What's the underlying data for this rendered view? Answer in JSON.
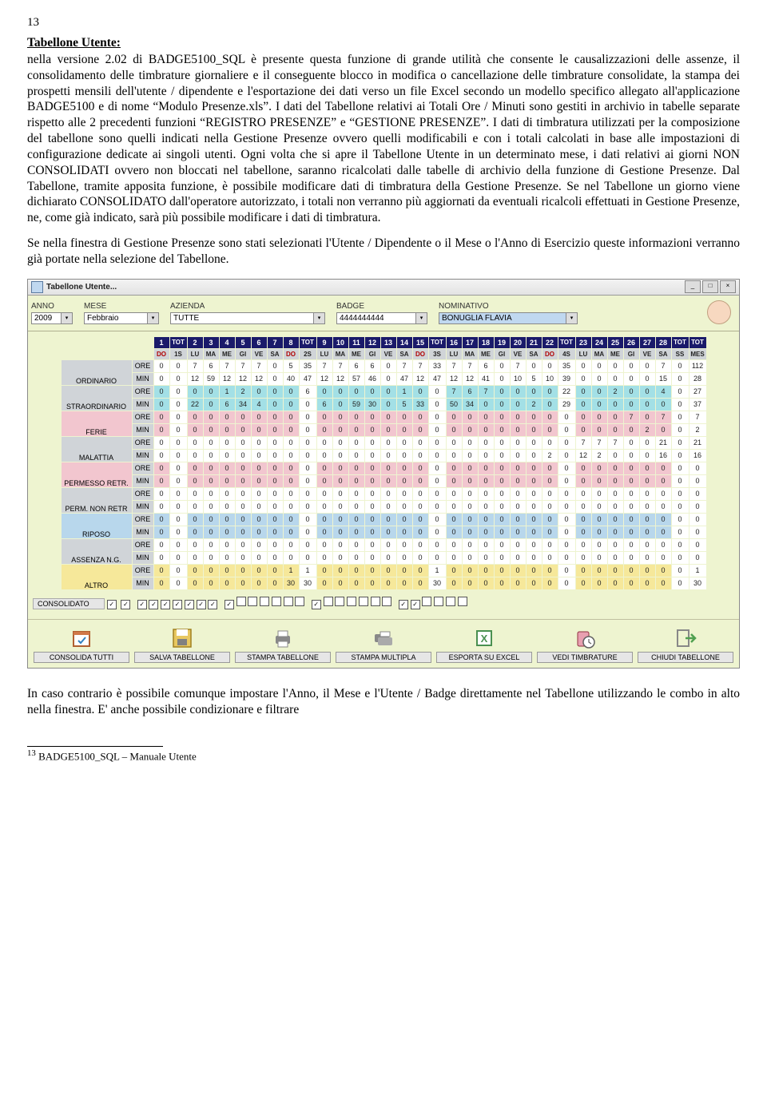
{
  "page": {
    "number": "13",
    "heading": "Tabellone Utente:",
    "para1": "nella versione 2.02 di BADGE5100_SQL è presente questa funzione di grande utilità che consente le causalizzazioni delle assenze, il consolidamento delle timbrature giornaliere e il conseguente blocco in modifica o cancellazione delle timbrature consolidate, la stampa dei prospetti mensili dell'utente / dipendente e l'esportazione dei dati verso un file Excel secondo un modello specifico allegato all'applicazione BADGE5100 e di nome “Modulo Presenze.xls”. I dati del Tabellone relativi ai Totali Ore / Minuti sono gestiti in archivio in tabelle separate rispetto alle 2 precedenti funzioni “REGISTRO PRESENZE” e “GESTIONE PRESENZE”. I dati di timbratura utilizzati per la composizione del tabellone sono quelli indicati nella Gestione Presenze ovvero quelli modificabili e con i totali calcolati in base alle impostazioni di configurazione dedicate ai singoli utenti. Ogni volta che si apre il Tabellone Utente in un determinato mese, i dati relativi ai giorni NON CONSOLIDATI ovvero non bloccati nel tabellone, saranno ricalcolati dalle tabelle di archivio della funzione di Gestione Presenze. Dal Tabellone, tramite apposita funzione, è possibile modificare dati di timbratura della Gestione Presenze. Se nel Tabellone un giorno viene dichiarato CONSOLIDATO dall'operatore autorizzato, i totali non verranno più aggiornati da eventuali ricalcoli effettuati in Gestione Presenze, ne, come già indicato, sarà più possibile modificare i dati di timbratura.",
    "para2": "Se nella finestra di Gestione Presenze sono stati selezionati l'Utente / Dipendente o il Mese o l'Anno di Esercizio queste informazioni verranno già portate nella selezione del Tabellone.",
    "para3": "In caso contrario è possibile comunque impostare l'Anno, il Mese e l'Utente / Badge direttamente nel Tabellone utilizzando le combo in alto nella finestra. E' anche possibile condizionare e filtrare",
    "footnote_num": "13",
    "footnote_text": "BADGE5100_SQL – Manuale Utente"
  },
  "app": {
    "title": "Tabellone Utente...",
    "filters": {
      "anno": {
        "label": "ANNO",
        "value": "2009"
      },
      "mese": {
        "label": "MESE",
        "value": "Febbraio"
      },
      "azienda": {
        "label": "AZIENDA",
        "value": "TUTTE"
      },
      "badge": {
        "label": "BADGE",
        "value": "4444444444"
      },
      "nominativo": {
        "label": "NOMINATIVO",
        "value": "BONUGLIA FLAVIA"
      }
    },
    "grid": {
      "days": [
        1,
        2,
        3,
        4,
        5,
        6,
        7,
        8,
        9,
        10,
        11,
        12,
        13,
        14,
        15,
        16,
        17,
        18,
        19,
        20,
        21,
        22,
        23,
        24,
        25,
        26,
        27,
        28
      ],
      "dow": [
        "DO",
        "LU",
        "MA",
        "ME",
        "GI",
        "VE",
        "SA",
        "DO",
        "LU",
        "MA",
        "ME",
        "GI",
        "VE",
        "SA",
        "DO",
        "LU",
        "MA",
        "ME",
        "GI",
        "VE",
        "SA",
        "DO",
        "LU",
        "MA",
        "ME",
        "GI",
        "VE",
        "SA"
      ],
      "tot_labels": {
        "t1": "TOT",
        "t2": "TOT",
        "t3": "TOT",
        "t4": "TOT",
        "tot": "TOT"
      },
      "dow_tot": {
        "t1": "1S",
        "t2": "2S",
        "t3": "3S",
        "t4": "4S",
        "ss": "SS",
        "mes": "MES"
      },
      "day_cols": 28,
      "rows": [
        {
          "label": "ORDINARIO",
          "unit_ore": "ORE",
          "unit_min": "MIN",
          "class": "",
          "ore": [
            0,
            7,
            6,
            7,
            7,
            7,
            0,
            5,
            7,
            7,
            6,
            6,
            0,
            7,
            7,
            7,
            7,
            6,
            0,
            7,
            0,
            0,
            0,
            0,
            0,
            0,
            0,
            7
          ],
          "min": [
            0,
            12,
            59,
            12,
            12,
            12,
            0,
            40,
            12,
            12,
            57,
            46,
            0,
            47,
            12,
            12,
            12,
            41,
            0,
            10,
            5,
            10,
            0,
            0,
            0,
            0,
            0,
            15
          ],
          "tot1_ore": 0,
          "tot1_min": 0,
          "tot2_ore": 35,
          "tot2_min": 47,
          "tot3_ore": 33,
          "tot3_min": 47,
          "tot4_ore": 35,
          "tot4_min": 39,
          "mes_ore": 112,
          "mes_min": 28
        },
        {
          "label": "STRAORDINARIO",
          "unit_ore": "ORE",
          "unit_min": "MIN",
          "class": "stra",
          "ore": [
            0,
            0,
            0,
            1,
            2,
            0,
            0,
            0,
            0,
            0,
            0,
            0,
            0,
            1,
            0,
            7,
            6,
            7,
            0,
            0,
            0,
            0,
            0,
            0,
            2,
            0,
            0,
            4
          ],
          "min": [
            0,
            22,
            0,
            6,
            34,
            4,
            0,
            0,
            6,
            0,
            59,
            30,
            0,
            5,
            33,
            50,
            34,
            0,
            0,
            0,
            2,
            0,
            0,
            0,
            0,
            0,
            0,
            0
          ],
          "tot1_ore": 0,
          "tot1_min": 0,
          "tot2_ore": 6,
          "tot2_min": 0,
          "tot3_ore": 0,
          "tot3_min": 0,
          "tot4_ore": 22,
          "tot4_min": 29,
          "mes_ore": 27,
          "mes_min": 37
        },
        {
          "label": "FERIE",
          "unit_ore": "ORE",
          "unit_min": "MIN",
          "class": "f",
          "ore": [
            0,
            0,
            0,
            0,
            0,
            0,
            0,
            0,
            0,
            0,
            0,
            0,
            0,
            0,
            0,
            0,
            0,
            0,
            0,
            0,
            0,
            0,
            0,
            0,
            0,
            7,
            0,
            7
          ],
          "min": [
            0,
            0,
            0,
            0,
            0,
            0,
            0,
            0,
            0,
            0,
            0,
            0,
            0,
            0,
            0,
            0,
            0,
            0,
            0,
            0,
            0,
            0,
            0,
            0,
            0,
            0,
            2,
            0
          ],
          "tot1_ore": 0,
          "tot1_min": 0,
          "tot2_ore": 0,
          "tot2_min": 0,
          "tot3_ore": 0,
          "tot3_min": 0,
          "tot4_ore": 0,
          "tot4_min": 0,
          "mes_ore": 7,
          "mes_min": 2
        },
        {
          "label": "MALATTIA",
          "unit_ore": "ORE",
          "unit_min": "MIN",
          "class": "",
          "ore": [
            0,
            0,
            0,
            0,
            0,
            0,
            0,
            0,
            0,
            0,
            0,
            0,
            0,
            0,
            0,
            0,
            0,
            0,
            0,
            0,
            0,
            0,
            7,
            7,
            7,
            0,
            0,
            21
          ],
          "min": [
            0,
            0,
            0,
            0,
            0,
            0,
            0,
            0,
            0,
            0,
            0,
            0,
            0,
            0,
            0,
            0,
            0,
            0,
            0,
            0,
            0,
            2,
            12,
            2,
            0,
            0,
            0,
            16
          ],
          "tot1_ore": 0,
          "tot1_min": 0,
          "tot2_ore": 0,
          "tot2_min": 0,
          "tot3_ore": 0,
          "tot3_min": 0,
          "tot4_ore": 0,
          "tot4_min": 0,
          "mes_ore": 21,
          "mes_min": 16
        },
        {
          "label": "PERMESSO RETR.",
          "unit_ore": "ORE",
          "unit_min": "MIN",
          "class": "f",
          "ore": [
            0,
            0,
            0,
            0,
            0,
            0,
            0,
            0,
            0,
            0,
            0,
            0,
            0,
            0,
            0,
            0,
            0,
            0,
            0,
            0,
            0,
            0,
            0,
            0,
            0,
            0,
            0,
            0
          ],
          "min": [
            0,
            0,
            0,
            0,
            0,
            0,
            0,
            0,
            0,
            0,
            0,
            0,
            0,
            0,
            0,
            0,
            0,
            0,
            0,
            0,
            0,
            0,
            0,
            0,
            0,
            0,
            0,
            0
          ],
          "tot1_ore": 0,
          "tot1_min": 0,
          "tot2_ore": 0,
          "tot2_min": 0,
          "tot3_ore": 0,
          "tot3_min": 0,
          "tot4_ore": 0,
          "tot4_min": 0,
          "mes_ore": 0,
          "mes_min": 0
        },
        {
          "label": "PERM. NON RETR",
          "unit_ore": "ORE",
          "unit_min": "MIN",
          "class": "",
          "ore": [
            0,
            0,
            0,
            0,
            0,
            0,
            0,
            0,
            0,
            0,
            0,
            0,
            0,
            0,
            0,
            0,
            0,
            0,
            0,
            0,
            0,
            0,
            0,
            0,
            0,
            0,
            0,
            0
          ],
          "min": [
            0,
            0,
            0,
            0,
            0,
            0,
            0,
            0,
            0,
            0,
            0,
            0,
            0,
            0,
            0,
            0,
            0,
            0,
            0,
            0,
            0,
            0,
            0,
            0,
            0,
            0,
            0,
            0
          ],
          "tot1_ore": 0,
          "tot1_min": 0,
          "tot2_ore": 0,
          "tot2_min": 0,
          "tot3_ore": 0,
          "tot3_min": 0,
          "tot4_ore": 0,
          "tot4_min": 0,
          "mes_ore": 0,
          "mes_min": 0
        },
        {
          "label": "RIPOSO",
          "unit_ore": "ORE",
          "unit_min": "MIN",
          "class": "r",
          "ore": [
            0,
            0,
            0,
            0,
            0,
            0,
            0,
            0,
            0,
            0,
            0,
            0,
            0,
            0,
            0,
            0,
            0,
            0,
            0,
            0,
            0,
            0,
            0,
            0,
            0,
            0,
            0,
            0
          ],
          "min": [
            0,
            0,
            0,
            0,
            0,
            0,
            0,
            0,
            0,
            0,
            0,
            0,
            0,
            0,
            0,
            0,
            0,
            0,
            0,
            0,
            0,
            0,
            0,
            0,
            0,
            0,
            0,
            0
          ],
          "tot1_ore": 0,
          "tot1_min": 0,
          "tot2_ore": 0,
          "tot2_min": 0,
          "tot3_ore": 0,
          "tot3_min": 0,
          "tot4_ore": 0,
          "tot4_min": 0,
          "mes_ore": 0,
          "mes_min": 0
        },
        {
          "label": "ASSENZA N.G.",
          "unit_ore": "ORE",
          "unit_min": "MIN",
          "class": "",
          "ore": [
            0,
            0,
            0,
            0,
            0,
            0,
            0,
            0,
            0,
            0,
            0,
            0,
            0,
            0,
            0,
            0,
            0,
            0,
            0,
            0,
            0,
            0,
            0,
            0,
            0,
            0,
            0,
            0
          ],
          "min": [
            0,
            0,
            0,
            0,
            0,
            0,
            0,
            0,
            0,
            0,
            0,
            0,
            0,
            0,
            0,
            0,
            0,
            0,
            0,
            0,
            0,
            0,
            0,
            0,
            0,
            0,
            0,
            0
          ],
          "tot1_ore": 0,
          "tot1_min": 0,
          "tot2_ore": 0,
          "tot2_min": 0,
          "tot3_ore": 0,
          "tot3_min": 0,
          "tot4_ore": 0,
          "tot4_min": 0,
          "mes_ore": 0,
          "mes_min": 0
        },
        {
          "label": "ALTRO",
          "unit_ore": "ORE",
          "unit_min": "MIN",
          "class": "a",
          "ore": [
            0,
            0,
            0,
            0,
            0,
            0,
            0,
            1,
            0,
            0,
            0,
            0,
            0,
            0,
            0,
            0,
            0,
            0,
            0,
            0,
            0,
            0,
            0,
            0,
            0,
            0,
            0,
            0
          ],
          "min": [
            0,
            0,
            0,
            0,
            0,
            0,
            0,
            30,
            0,
            0,
            0,
            0,
            0,
            0,
            0,
            0,
            0,
            0,
            0,
            0,
            0,
            0,
            0,
            0,
            0,
            0,
            0,
            0
          ],
          "tot1_ore": 0,
          "tot1_min": 0,
          "tot2_ore": 1,
          "tot2_min": 30,
          "tot3_ore": 1,
          "tot3_min": 30,
          "tot4_ore": 0,
          "tot4_min": 0,
          "mes_ore": 1,
          "mes_min": 30
        }
      ],
      "consolidato_label": "CONSOLIDATO",
      "consolidato": [
        true,
        true,
        true,
        true,
        true,
        true,
        true,
        true,
        true,
        false,
        false,
        false,
        false,
        false,
        false,
        true,
        false,
        false,
        false,
        false,
        false,
        false,
        true,
        true,
        false,
        false,
        false,
        false
      ]
    },
    "toolbar": [
      "CONSOLIDA TUTTI",
      "SALVA TABELLONE",
      "STAMPA TABELLONE",
      "STAMPA MULTIPLA",
      "ESPORTA SU EXCEL",
      "VEDI TIMBRATURE",
      "CHIUDI TABELLONE"
    ]
  }
}
